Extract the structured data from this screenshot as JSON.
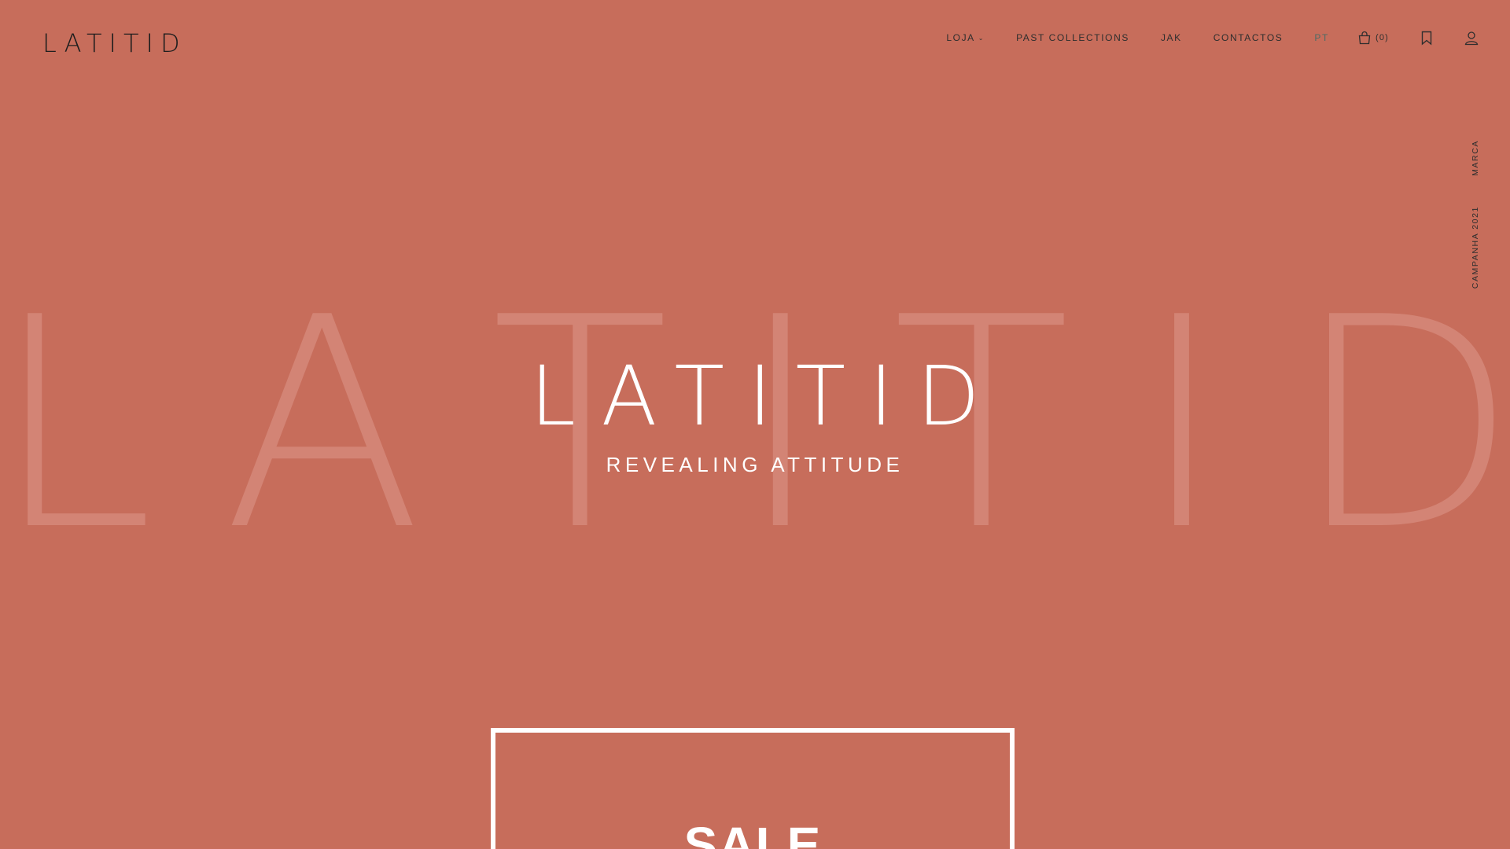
{
  "header": {
    "logo": "LATITID",
    "nav": [
      {
        "label": "LOJA",
        "has_dropdown": true
      },
      {
        "label": "PAST COLLECTIONS"
      },
      {
        "label": "JAK"
      },
      {
        "label": "CONTACTOS"
      }
    ],
    "language": "PT",
    "cart_count": "(0)",
    "icons": [
      "bag-icon",
      "bookmark-icon",
      "user-icon"
    ]
  },
  "side_links": {
    "marca": "MARCA",
    "campanha": "CAMPANHA 2021"
  },
  "background_word": [
    "L",
    "A",
    "T",
    "I",
    "T",
    "I",
    "D"
  ],
  "hero": {
    "title": "LATITID",
    "tagline": "REVEALING ATTITUDE"
  },
  "sale": {
    "label": "SALE"
  },
  "colors": {
    "background": "#c76d5b",
    "background_word": "#d88c7e",
    "text_dark": "#2e2e2e",
    "language_accent": "#4d6b66",
    "white": "#ffffff"
  }
}
